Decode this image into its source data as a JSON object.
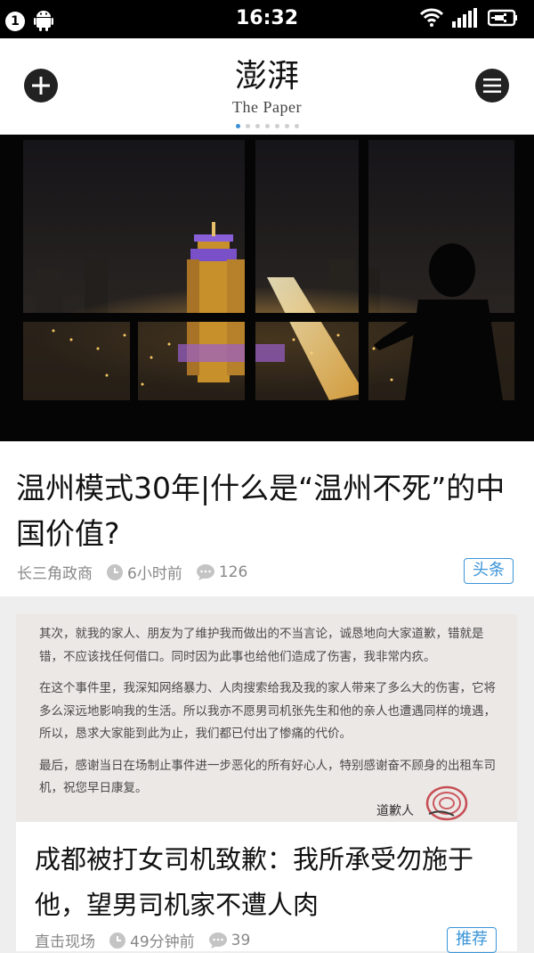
{
  "status_bar": {
    "notification_count": "1",
    "time": "16:32"
  },
  "header": {
    "brand_cn": "澎湃",
    "brand_en": "The Paper",
    "page_dots": 7,
    "active_dot": 0
  },
  "articles": [
    {
      "title": "温州模式30年|什么是“温州不死”的中国价值?",
      "source": "长三角政商",
      "time": "6小时前",
      "comments": "126",
      "tag": "头条"
    },
    {
      "title": "成都被打女司机致歉：我所承受勿施于他，望男司机家不遭人肉",
      "source": "直击现场",
      "time": "49分钟前",
      "comments": "39",
      "tag": "推荐",
      "image_text": {
        "paragraphs": [
          "其次，就我的家人、朋友为了维护我而做出的不当言论，诚恳地向大家道歉，错就是错，不应该找任何借口。同时因为此事也给他们造成了伤害，我非常内疚。",
          "在这个事件里，我深知网络暴力、人肉搜索给我及我的家人带来了多么大的伤害，它将多么深远地影响我的生活。所以我亦不愿男司机张先生和他的亲人也遭遇同样的境遇，所以，恳求大家能到此为止，我们都已付出了惨痛的代价。",
          "最后，感谢当日在场制止事件进一步恶化的所有好心人，特别感谢奋不顾身的出租车司机，祝您早日康复。"
        ],
        "signature": "道歉人"
      }
    }
  ],
  "colors": {
    "accent": "#3a95d8",
    "page_bg": "#eeeeee"
  }
}
